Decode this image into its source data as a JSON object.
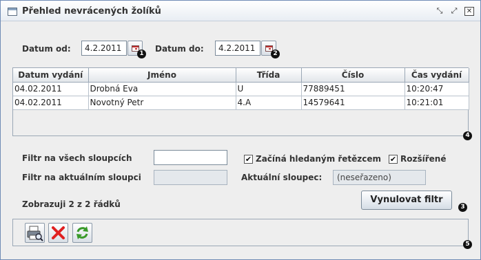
{
  "window": {
    "title": "Přehled nevrácených žolíků",
    "controls": [
      "restore-icon",
      "maximize-icon",
      "close-icon"
    ]
  },
  "dates": {
    "from_label": "Datum od:",
    "from_value": "4.2.2011",
    "to_label": "Datum do:",
    "to_value": "4.2.2011",
    "badge_1": "1",
    "badge_2": "2"
  },
  "table": {
    "columns": [
      "Datum vydání",
      "Jméno",
      "Třída",
      "Číslo",
      "Čas vydání"
    ],
    "rows": [
      [
        "04.02.2011",
        "Drobná Eva",
        "U",
        "77889451",
        "10:20:47"
      ],
      [
        "04.02.2011",
        "Novotný Petr",
        "4.A",
        "14579641",
        "10:21:01"
      ]
    ],
    "badge": "4"
  },
  "filter": {
    "all_columns_label": "Filtr na všech sloupcích",
    "all_columns_value": "",
    "current_column_label": "Filtr na aktuálním sloupci",
    "current_column_value": "",
    "starts_with_label": "Začíná hledaným řetězcem",
    "starts_with_checked": true,
    "extended_label": "Rozšířené",
    "extended_checked": true,
    "current_column_name_label": "Aktuální sloupec:",
    "current_column_name_value": "(neseřazeno)",
    "rows_info": "Zobrazuji 2 z 2 řádků",
    "reset_button": "Vynulovat filtr",
    "badge": "3"
  },
  "toolbar": {
    "buttons": [
      "print-preview-icon",
      "delete-icon",
      "refresh-icon"
    ],
    "badge": "5"
  },
  "colors": {
    "window_border": "#6f8bb5",
    "background": "#eeeeee",
    "delete_red": "#e02020",
    "refresh_green": "#3a9a2a"
  }
}
